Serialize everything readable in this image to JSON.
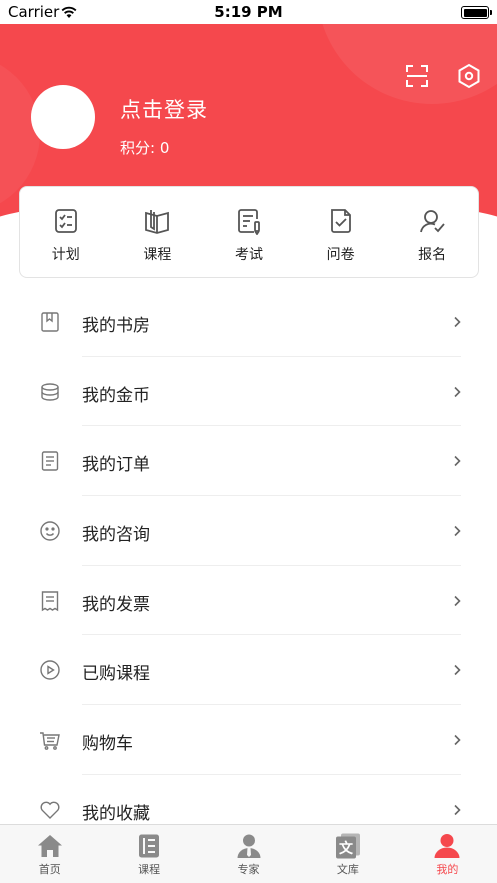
{
  "status_bar": {
    "carrier": "Carrier",
    "time": "5:19 PM"
  },
  "profile": {
    "login_prompt": "点击登录",
    "points_label": "积分: 0"
  },
  "colors": {
    "brand": "#f5484d",
    "icon_gray": "#777777",
    "tab_gray": "#8a8a8a"
  },
  "quick_actions": [
    {
      "label": "计划",
      "icon": "checklist-icon"
    },
    {
      "label": "课程",
      "icon": "book-icon"
    },
    {
      "label": "考试",
      "icon": "exam-icon"
    },
    {
      "label": "问卷",
      "icon": "survey-icon"
    },
    {
      "label": "报名",
      "icon": "signup-icon"
    }
  ],
  "menu": [
    {
      "label": "我的书房",
      "icon": "bookmark-icon"
    },
    {
      "label": "我的金币",
      "icon": "coins-icon"
    },
    {
      "label": "我的订单",
      "icon": "order-icon"
    },
    {
      "label": "我的咨询",
      "icon": "smile-icon"
    },
    {
      "label": "我的发票",
      "icon": "receipt-icon"
    },
    {
      "label": "已购课程",
      "icon": "play-icon"
    },
    {
      "label": "购物车",
      "icon": "cart-icon"
    },
    {
      "label": "我的收藏",
      "icon": "heart-icon"
    }
  ],
  "tabs": [
    {
      "label": "首页",
      "icon": "home-icon",
      "active": false
    },
    {
      "label": "课程",
      "icon": "course-icon",
      "active": false
    },
    {
      "label": "专家",
      "icon": "expert-icon",
      "active": false
    },
    {
      "label": "文库",
      "icon": "library-icon",
      "active": false,
      "glyph": "文"
    },
    {
      "label": "我的",
      "icon": "profile-icon",
      "active": true
    }
  ]
}
